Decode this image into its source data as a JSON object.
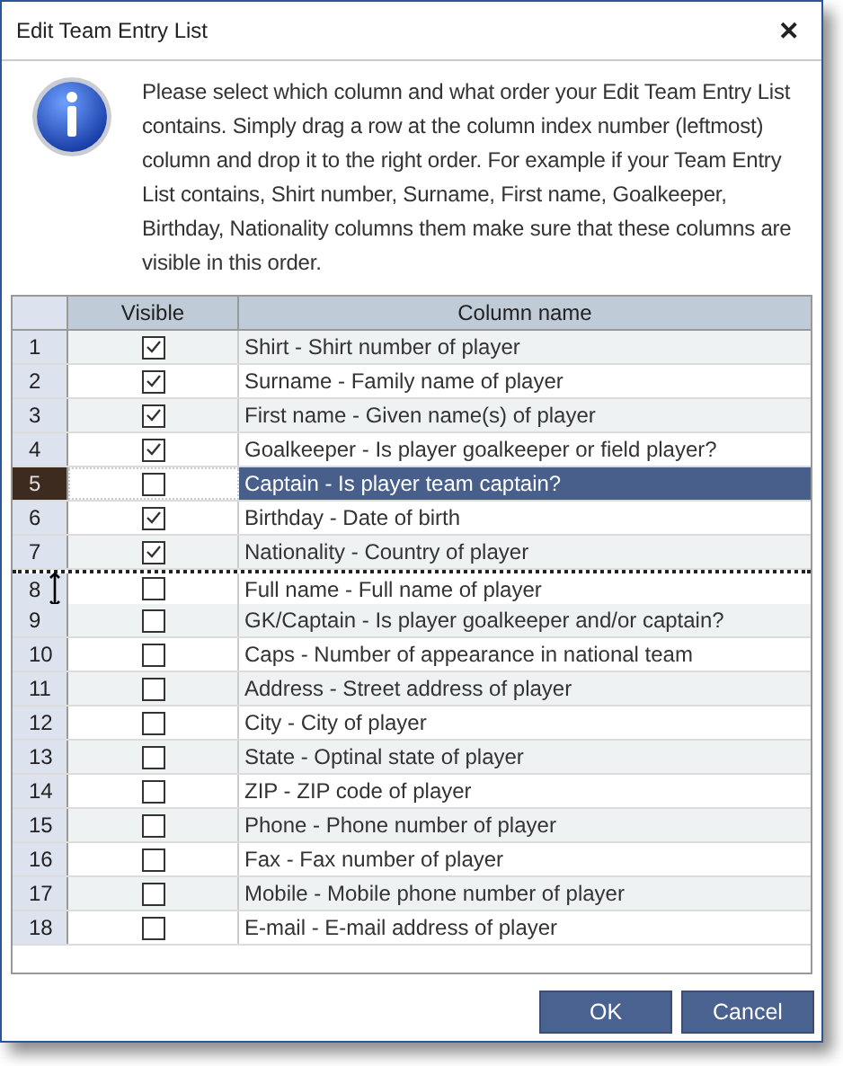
{
  "window": {
    "title": "Edit Team Entry List",
    "close": "✕"
  },
  "message": "Please select which column and what order your Edit Team Entry List contains. Simply drag a row at the column index number (leftmost) column and drop it to the right order. For example if your Team Entry List contains, Shirt number, Surname, First name, Goalkeeper, Birthday, Nationality columns them make sure that these columns are visible in this order.",
  "table": {
    "columns": [
      "Visible",
      "Column name"
    ],
    "rows": [
      {
        "index": "1",
        "checked": true,
        "name": "Shirt - Shirt number of player",
        "selected": false,
        "drop_before": false
      },
      {
        "index": "2",
        "checked": true,
        "name": "Surname - Family name of player",
        "selected": false,
        "drop_before": false
      },
      {
        "index": "3",
        "checked": true,
        "name": "First name - Given name(s) of player",
        "selected": false,
        "drop_before": false
      },
      {
        "index": "4",
        "checked": true,
        "name": "Goalkeeper - Is player goalkeeper or field player?",
        "selected": false,
        "drop_before": false
      },
      {
        "index": "5",
        "checked": false,
        "name": "Captain - Is player team captain?",
        "selected": true,
        "drop_before": false
      },
      {
        "index": "6",
        "checked": true,
        "name": "Birthday - Date of birth",
        "selected": false,
        "drop_before": false
      },
      {
        "index": "7",
        "checked": true,
        "name": "Nationality - Country of player",
        "selected": false,
        "drop_before": false
      },
      {
        "index": "8",
        "checked": false,
        "name": "Full name - Full name of player",
        "selected": false,
        "drop_before": true
      },
      {
        "index": "9",
        "checked": false,
        "name": "GK/Captain - Is player goalkeeper and/or captain?",
        "selected": false,
        "drop_before": false
      },
      {
        "index": "10",
        "checked": false,
        "name": "Caps - Number of appearance in national team",
        "selected": false,
        "drop_before": false
      },
      {
        "index": "11",
        "checked": false,
        "name": "Address - Street address of player",
        "selected": false,
        "drop_before": false
      },
      {
        "index": "12",
        "checked": false,
        "name": "City - City of player",
        "selected": false,
        "drop_before": false
      },
      {
        "index": "13",
        "checked": false,
        "name": "State - Optinal state of player",
        "selected": false,
        "drop_before": false
      },
      {
        "index": "14",
        "checked": false,
        "name": "ZIP - ZIP code of player",
        "selected": false,
        "drop_before": false
      },
      {
        "index": "15",
        "checked": false,
        "name": "Phone - Phone number of player",
        "selected": false,
        "drop_before": false
      },
      {
        "index": "16",
        "checked": false,
        "name": "Fax - Fax number of player",
        "selected": false,
        "drop_before": false
      },
      {
        "index": "17",
        "checked": false,
        "name": "Mobile - Mobile phone number of player",
        "selected": false,
        "drop_before": false
      },
      {
        "index": "18",
        "checked": false,
        "name": "E-mail - E-mail address of player",
        "selected": false,
        "drop_before": false
      }
    ]
  },
  "buttons": [
    "OK",
    "Cancel"
  ]
}
